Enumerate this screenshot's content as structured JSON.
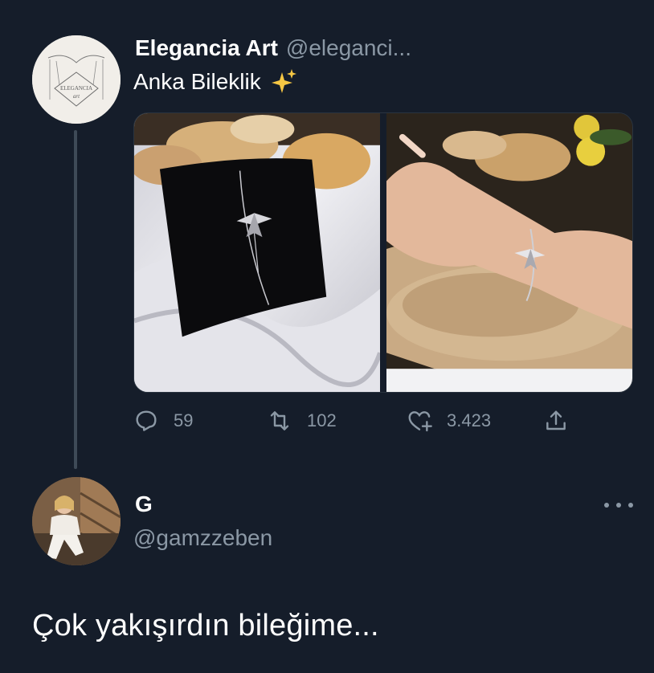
{
  "tweet": {
    "author_name": "Elegancia Art",
    "author_handle": "@eleganci...",
    "avatar_logo_text": "ELEGANCIA",
    "avatar_logo_subtext": "art",
    "text": "Anka Bileklik",
    "emoji_icon": "sparkles-icon",
    "media": [
      {
        "name": "bracelet-on-display-photo",
        "icon": "photo"
      },
      {
        "name": "bracelet-on-wrist-photo",
        "icon": "photo"
      }
    ],
    "actions": {
      "reply_count": "59",
      "retweet_count": "102",
      "like_count": "3.423"
    }
  },
  "reply": {
    "author_name": "G",
    "author_handle": "@gamzzeben",
    "text": "Çok yakışırdın bileğime..."
  },
  "colors": {
    "background": "#151d2a",
    "muted_text": "#8b98a5",
    "thread_line": "#3e4a57"
  }
}
